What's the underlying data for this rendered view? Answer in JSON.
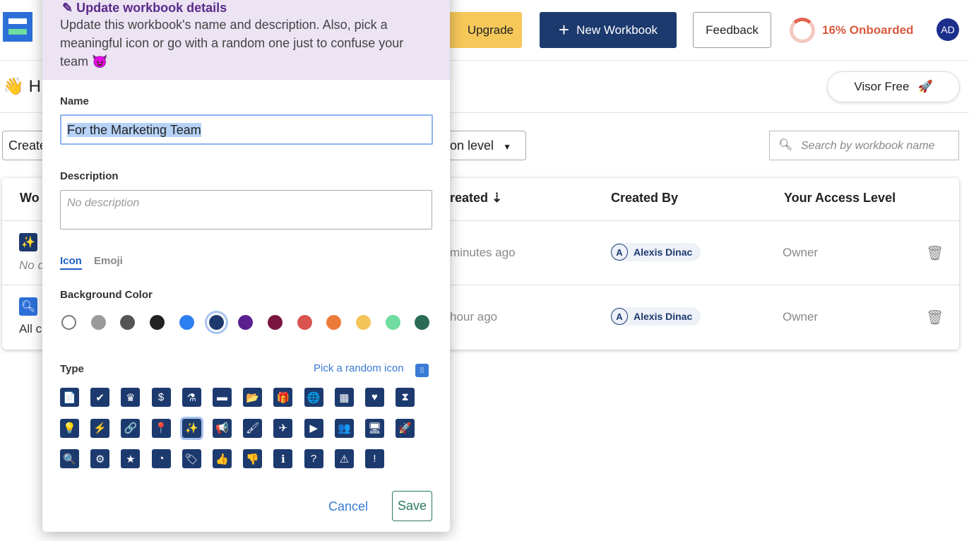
{
  "header": {
    "upgrade": "Upgrade",
    "new_workbook": "New Workbook",
    "feedback": "Feedback",
    "onboarded": "16% Onboarded",
    "onboarded_percent": 16,
    "avatar": "AD",
    "plan": "Visor Free"
  },
  "page": {
    "greeting_emoji": "👋",
    "greeting": "H",
    "filter_created": "Create",
    "filter_access": "on level",
    "search_placeholder": "Search by workbook name"
  },
  "table": {
    "columns": [
      "Wo",
      "reated",
      "Created By",
      "Your Access Level"
    ],
    "rows": [
      {
        "desc": "No d",
        "created": "minutes ago",
        "created_by": "Alexis Dinac",
        "access": "Owner",
        "icon": "magic-wand",
        "icon_color": "#1c3a6e"
      },
      {
        "desc": "All c",
        "created": "hour ago",
        "created_by": "Alexis Dinac",
        "access": "Owner",
        "icon": "search",
        "icon_color": "#2d6fd9"
      }
    ]
  },
  "modal": {
    "title": "Update workbook details",
    "description": "Update this workbook's name and description. Also, pick a meaningful icon or go with a random one just to confuse your team 😈",
    "name_label": "Name",
    "name_value": "For the Marketing Team",
    "description_label": "Description",
    "description_placeholder": "No description",
    "tabs": [
      "Icon",
      "Emoji"
    ],
    "active_tab": "Icon",
    "bg_label": "Background Color",
    "colors": [
      "#ffffff",
      "#9a9a9a",
      "#555555",
      "#222222",
      "#2d7ef0",
      "#1c3a6e",
      "#5b1f8f",
      "#7a1540",
      "#d9534f",
      "#ee7a3a",
      "#f2c45a",
      "#6fdca0",
      "#2a6b55"
    ],
    "selected_color": "#1c3a6e",
    "type_label": "Type",
    "random_label": "Pick a random icon",
    "icons": [
      "📄",
      "✔",
      "♛",
      "$",
      "⚗",
      "▬",
      "📂",
      "🎁",
      "🌐",
      "▦",
      "♥",
      "⧗",
      "💡",
      "⚡",
      "🔗",
      "📍",
      "✨",
      "📢",
      "🖌",
      "✈",
      "▶",
      "👥",
      "🖥",
      "🚀",
      "🔍",
      "⚙",
      "★",
      "◔",
      "🏷",
      "👍",
      "👎",
      "ℹ",
      "?",
      "⚠",
      "!"
    ],
    "selected_icon": 16,
    "cancel": "Cancel",
    "save": "Save"
  }
}
